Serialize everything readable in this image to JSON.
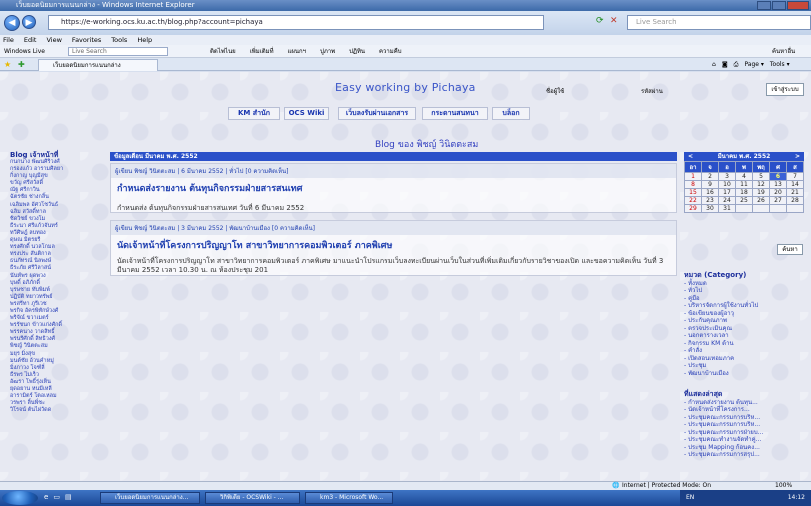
{
  "window": {
    "title": "เว็บยอดนิยมการแนนกล่าง - Windows Internet Explorer"
  },
  "addressbar": {
    "url": "https://e-working.ocs.ku.ac.th/blog.php?account=pichaya",
    "live_search_placeholder": "Live Search"
  },
  "menubar": {
    "items": [
      "File",
      "Edit",
      "View",
      "Favorites",
      "Tools",
      "Help"
    ]
  },
  "windows_live": {
    "label": "Windows Live",
    "search_placeholder": "Live Search",
    "links": [
      "ติดไฟไนย",
      "เพิ่มเติมที่",
      "แผนกฯ",
      "ปูภาพ",
      "ปฏิทิน",
      "ความคืบ"
    ],
    "right_label": "ค้นหาอื่น"
  },
  "tabs": {
    "active_label": "เว็บยอดนิยมการแนนกล่าง",
    "toolbar_items": [
      "Page ▾",
      "Tools ▾"
    ]
  },
  "site": {
    "title": "Easy working by Pichaya",
    "header_labels": [
      "ชื่อผู้ใช้",
      "รหัสผ่าน"
    ],
    "login_button": "เข้าสู่ระบบ",
    "nav": [
      "KM สำนัก",
      "OCS Wiki",
      "เว็บลงรับผ่านเอกสาร",
      "กระดานสนทนา",
      "บล็อก"
    ],
    "blog_heading": "Blog ของ พิชญ์ วินิตตะสม"
  },
  "sidebar_left": {
    "title": "Blog เจ้าหน้าที่",
    "items": [
      "กนกนาง พัฒนศิริวงศ์",
      "กรองแก้ว อารามศิลยา",
      "กิ่งกาญ บุญมีสุข",
      "ขวัญ ศรีสวัสดิ์",
      "ณัฐ ศรีกาวิน",
      "ฉัตรชัย ช่างกลิ้น",
      "เฉลิมพล อัศวโชวันธ์",
      "ฉลิม สวัสดิ์ทาล",
      "ชิดวิชย์ ขวงโม",
      "ธีระนา ศรีแก้วจันทร์",
      "ทวีศิษฎ์ ลบทอง",
      "ดุษณ มิตรยรี",
      "ทรงศักดิ์ นวลโกมล",
      "ทรงประ สันติกาล",
      "ธนภัทรณ์ นิลพงษ์",
      "ธีระภัย ศรีวิลาสน์",
      "นันท์พร ผุดพวง",
      "บุษดิ์ อภิภักดิ์",
      "บุรษชาย ทับพิมพ์",
      "ปฏิบัติ ทยาวทรัพย์",
      "พรสรีทา ภูรีเวช",
      "พรกิจ อัครพิทักษ์วงศ์",
      "พริจัณ์ ขวาเมตร์",
      "พรรัชนก ข้าวแก่งศักดิ์",
      "พรรคนาง วาดสิทธิ์",
      "พรนรีศักดิ์ สิทธิวงศ์",
      "พิชญ์ วินิตตะสม",
      "มยุร มิ่งสุข",
      "มนต์ชัย อ้วนคำหมู่",
      "มิ่งภาวง โจฑ์ลี่",
      "ธีรพร ไม่เร็ว",
      "อัฒรา โพธิ์รุ่งเห็น",
      "ยุดอยาน หนมีเหลี",
      "อารามิตร์ โตอเหลม",
      "วรพรา ลิ้นพี่ชะ",
      "วิโรจน์ ต้นไผ่วัดด"
    ]
  },
  "posts_month": "ข้อมูลเดือน มีนาคม พ.ศ. 2552",
  "posts": [
    {
      "meta": "ผู้เขียน พิชญ์ วินิตตะสม | 6 มีนาคม 2552 | ทั่วไป  [0 ความคิดเห็น]",
      "title": "กำหนดส่งรายงาน ต้นทุนกิจกรรมฝ่ายสารสนเทศ",
      "body": "กำหนดส่ง ต้นทุนกิจกรรมฝ่ายสารสนเทศ วันที่ 6 มีนาคม 2552"
    },
    {
      "meta": "ผู้เขียน พิชญ์ วินิตตะสม | 3 มีนาคม 2552 | พัฒนาบ้านเมือง  [0 ความคิดเห็น]",
      "title": "นัดเจ้าหน้าที่โครงการปริญญาโท สาขาวิทยาการคอมพิวเตอร์ ภาคพิเศษ",
      "body": "นัดเจ้าหน้าที่โครงการปริญญาโท สาขาวิทยาการคอมพิวเตอร์ ภาคพิเศษ มาแนะนำโปรแกรมเว็บลงทะเบียนผ่านเว็บในส่วนที่เพิ่มเติมเกี่ยวกับรายวิชาของเปิด และขอความคิดเห็น  วันที่ 3 มีนาคม 2552 เวลา 10.30 น. ณ ห้องประชุม 201"
    }
  ],
  "calendar": {
    "title": "มีนาคม พ.ศ. 2552",
    "prev": "<",
    "next": ">",
    "days_of_week": [
      "อา",
      "จ",
      "อ",
      "พ",
      "พฤ",
      "ศ",
      "ส"
    ],
    "weeks": [
      [
        "1",
        "2",
        "3",
        "4",
        "5",
        "6",
        "7"
      ],
      [
        "8",
        "9",
        "10",
        "11",
        "12",
        "13",
        "14"
      ],
      [
        "15",
        "16",
        "17",
        "18",
        "19",
        "20",
        "21"
      ],
      [
        "22",
        "23",
        "24",
        "25",
        "26",
        "27",
        "28"
      ],
      [
        "29",
        "30",
        "31",
        "",
        "",
        "",
        ""
      ]
    ],
    "today": "6"
  },
  "search_button": "ค้นหา",
  "categories": {
    "title": "หมวด (Category)",
    "items": [
      "ทั้งหมด",
      "ทั่วไป",
      "คู่มือ",
      "บริหารจัดการผู้ใช้งานทั่วไป",
      "ข้อเขียนของผู้อาวุ",
      "ประกันคุณภาพ",
      "ตรวจประเมินคุณ",
      "นอกตารางเวลา",
      "กิจกรรม KM ด้าน",
      "คำสั่ง",
      "เปิดสอนเทอมภาค",
      "ประชุม",
      "พัฒนาบ้านเมือง"
    ]
  },
  "recent": {
    "title": "ที่แสดงล่าสุด",
    "items": [
      "กำหนดส่งรายงาน ต้นทุน...",
      "นัดเจ้าหน้าที่โครงการ...",
      "ประชุมคณะกรรมการบริห...",
      "ประชุมคณะกรรมการบริห...",
      "ประชุมคณะกรรมการฝ่ายบ...",
      "ประชุมคณะทำงานจัดทำคู่...",
      "ประชุม Mapping ก้อนคง...",
      "ประชุมคณะกรรมการสรุป..."
    ]
  },
  "statusbar": {
    "zone": "Internet | Protected Mode: On",
    "zoom": "100%"
  },
  "taskbar": {
    "buttons": [
      "เว็บยอดนิยมการแนนกล่าง...",
      "วิกิพิเดีย - OCSWiki - ...",
      "km3 - Microsoft Wo..."
    ],
    "tray_lang": "EN",
    "clock": "14:12"
  },
  "colors": {
    "accent": "#2a50c9",
    "link": "#1f3fb0",
    "title": "#3a55c8"
  }
}
